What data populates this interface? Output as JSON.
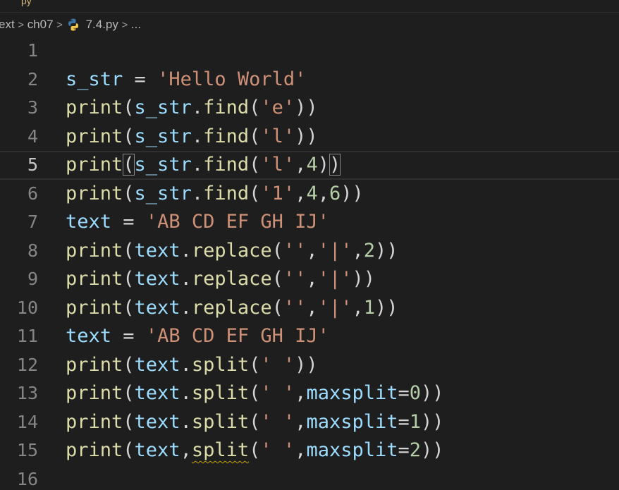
{
  "tab": {
    "label": "py"
  },
  "breadcrumb": {
    "items": [
      "ext",
      "ch07",
      "7.4.py",
      "..."
    ],
    "separator": ">"
  },
  "editor": {
    "current_line": 5,
    "lines": [
      {
        "num": "1",
        "tokens": []
      },
      {
        "num": "2",
        "tokens": [
          [
            "var",
            "s_str"
          ],
          [
            "op",
            " = "
          ],
          [
            "str",
            "'Hello World'"
          ]
        ]
      },
      {
        "num": "3",
        "tokens": [
          [
            "fn",
            "print"
          ],
          [
            "pn",
            "("
          ],
          [
            "var",
            "s_str"
          ],
          [
            "pn",
            "."
          ],
          [
            "fn",
            "find"
          ],
          [
            "pn",
            "("
          ],
          [
            "str",
            "'e'"
          ],
          [
            "pn",
            "))"
          ]
        ]
      },
      {
        "num": "4",
        "tokens": [
          [
            "fn",
            "print"
          ],
          [
            "pn",
            "("
          ],
          [
            "var",
            "s_str"
          ],
          [
            "pn",
            "."
          ],
          [
            "fn",
            "find"
          ],
          [
            "pn",
            "("
          ],
          [
            "str",
            "'l'"
          ],
          [
            "pn",
            "))"
          ]
        ]
      },
      {
        "num": "5",
        "tokens": [
          [
            "fn",
            "print"
          ],
          [
            "pnhl",
            "("
          ],
          [
            "var",
            "s_str"
          ],
          [
            "pn",
            "."
          ],
          [
            "fn",
            "find"
          ],
          [
            "pn",
            "("
          ],
          [
            "str",
            "'l'"
          ],
          [
            "pn",
            ","
          ],
          [
            "num",
            "4"
          ],
          [
            "pn",
            ")"
          ],
          [
            "pnhl",
            ")"
          ]
        ]
      },
      {
        "num": "6",
        "tokens": [
          [
            "fn",
            "print"
          ],
          [
            "pn",
            "("
          ],
          [
            "var",
            "s_str"
          ],
          [
            "pn",
            "."
          ],
          [
            "fn",
            "find"
          ],
          [
            "pn",
            "("
          ],
          [
            "str",
            "'1'"
          ],
          [
            "pn",
            ","
          ],
          [
            "num",
            "4"
          ],
          [
            "pn",
            ","
          ],
          [
            "num",
            "6"
          ],
          [
            "pn",
            "))"
          ]
        ]
      },
      {
        "num": "7",
        "tokens": [
          [
            "var",
            "text"
          ],
          [
            "op",
            " = "
          ],
          [
            "str",
            "'AB CD EF GH IJ'"
          ]
        ]
      },
      {
        "num": "8",
        "tokens": [
          [
            "fn",
            "print"
          ],
          [
            "pn",
            "("
          ],
          [
            "var",
            "text"
          ],
          [
            "pn",
            "."
          ],
          [
            "fn",
            "replace"
          ],
          [
            "pn",
            "("
          ],
          [
            "str",
            "''"
          ],
          [
            "pn",
            ","
          ],
          [
            "str",
            "'|'"
          ],
          [
            "pn",
            ","
          ],
          [
            "num",
            "2"
          ],
          [
            "pn",
            "))"
          ]
        ]
      },
      {
        "num": "9",
        "tokens": [
          [
            "fn",
            "print"
          ],
          [
            "pn",
            "("
          ],
          [
            "var",
            "text"
          ],
          [
            "pn",
            "."
          ],
          [
            "fn",
            "replace"
          ],
          [
            "pn",
            "("
          ],
          [
            "str",
            "''"
          ],
          [
            "pn",
            ","
          ],
          [
            "str",
            "'|'"
          ],
          [
            "pn",
            "))"
          ]
        ]
      },
      {
        "num": "10",
        "tokens": [
          [
            "fn",
            "print"
          ],
          [
            "pn",
            "("
          ],
          [
            "var",
            "text"
          ],
          [
            "pn",
            "."
          ],
          [
            "fn",
            "replace"
          ],
          [
            "pn",
            "("
          ],
          [
            "str",
            "''"
          ],
          [
            "pn",
            ","
          ],
          [
            "str",
            "'|'"
          ],
          [
            "pn",
            ","
          ],
          [
            "num",
            "1"
          ],
          [
            "pn",
            "))"
          ]
        ]
      },
      {
        "num": "11",
        "tokens": [
          [
            "var",
            "text"
          ],
          [
            "op",
            " = "
          ],
          [
            "str",
            "'AB CD EF GH IJ'"
          ]
        ]
      },
      {
        "num": "12",
        "tokens": [
          [
            "fn",
            "print"
          ],
          [
            "pn",
            "("
          ],
          [
            "var",
            "text"
          ],
          [
            "pn",
            "."
          ],
          [
            "fn",
            "split"
          ],
          [
            "pn",
            "("
          ],
          [
            "str",
            "' '"
          ],
          [
            "pn",
            "))"
          ]
        ]
      },
      {
        "num": "13",
        "tokens": [
          [
            "fn",
            "print"
          ],
          [
            "pn",
            "("
          ],
          [
            "var",
            "text"
          ],
          [
            "pn",
            "."
          ],
          [
            "fn",
            "split"
          ],
          [
            "pn",
            "("
          ],
          [
            "str",
            "' '"
          ],
          [
            "pn",
            ","
          ],
          [
            "var",
            "maxsplit"
          ],
          [
            "op",
            "="
          ],
          [
            "num",
            "0"
          ],
          [
            "pn",
            "))"
          ]
        ]
      },
      {
        "num": "14",
        "tokens": [
          [
            "fn",
            "print"
          ],
          [
            "pn",
            "("
          ],
          [
            "var",
            "text"
          ],
          [
            "pn",
            "."
          ],
          [
            "fn",
            "split"
          ],
          [
            "pn",
            "("
          ],
          [
            "str",
            "' '"
          ],
          [
            "pn",
            ","
          ],
          [
            "var",
            "maxsplit"
          ],
          [
            "op",
            "="
          ],
          [
            "num",
            "1"
          ],
          [
            "pn",
            "))"
          ]
        ]
      },
      {
        "num": "15",
        "tokens": [
          [
            "fn",
            "print"
          ],
          [
            "pn",
            "("
          ],
          [
            "var",
            "text"
          ],
          [
            "pn",
            ","
          ],
          [
            "fnsq",
            "split"
          ],
          [
            "pn",
            "("
          ],
          [
            "str",
            "' '"
          ],
          [
            "pn",
            ","
          ],
          [
            "var",
            "maxsplit"
          ],
          [
            "op",
            "="
          ],
          [
            "num",
            "2"
          ],
          [
            "pn",
            "))"
          ]
        ]
      },
      {
        "num": "16",
        "tokens": []
      }
    ]
  },
  "colors": {
    "background": "#1e1e1e",
    "function": "#dcdcaa",
    "variable": "#9cdcfe",
    "string": "#ce9178",
    "number": "#b5cea8",
    "line_number": "#858585",
    "warning_squiggle": "#c6a400"
  },
  "icons": {
    "file_icon": "python-icon"
  }
}
